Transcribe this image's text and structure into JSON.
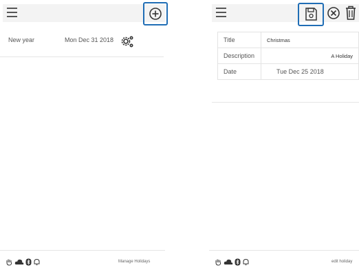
{
  "left": {
    "list": [
      {
        "name": "New year",
        "date": "Mon Dec 31 2018"
      }
    ],
    "footer_text": "Manage Holidays"
  },
  "right": {
    "detail": {
      "title_label": "Title",
      "title_value": "Christmas",
      "description_label": "Description",
      "description_value": "A Holiday",
      "date_label": "Date",
      "date_value": "Tue Dec 25 2018"
    },
    "footer_text": "edit holiday"
  },
  "colors": {
    "highlight": "#1f6db5",
    "topbar": "#f3f3f3",
    "icon": "#333333"
  },
  "icons": [
    "menu-icon",
    "add-icon",
    "settings-icon",
    "save-icon",
    "cancel-icon",
    "delete-icon",
    "hand-icon",
    "cloud-icon",
    "bluetooth-icon",
    "bell-icon"
  ]
}
